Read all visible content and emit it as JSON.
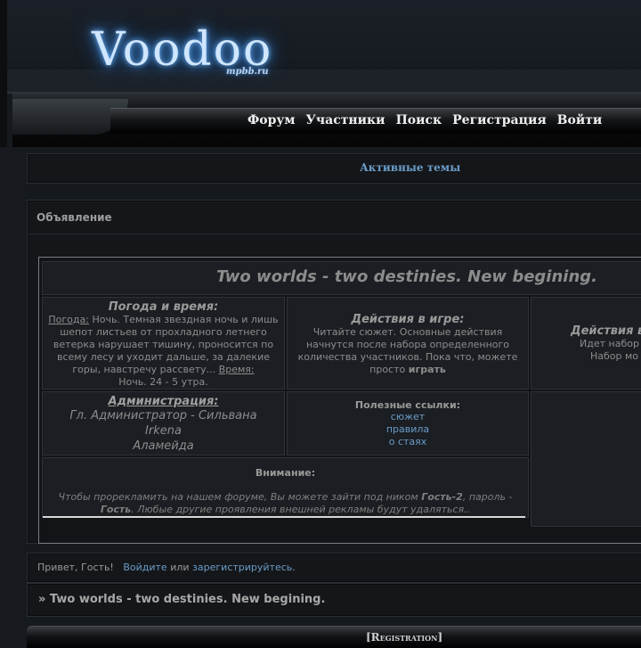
{
  "header": {
    "logo_text": "Voodoo",
    "logo_sub": "mpbb.ru"
  },
  "nav": {
    "items": [
      "Форум",
      "Участники",
      "Поиск",
      "Регистрация",
      "Войти"
    ]
  },
  "active_topics": "Активные темы",
  "announcement": {
    "title": "Объявление",
    "banner": "Two worlds - two destinies. New begining.",
    "weather": {
      "heading": "Погода и время:",
      "weather_label": "Погода:",
      "weather_text": "Ночь. Темная звездная ночь и лишь шепот листьев от прохладного летнего ветерка нарушает тишину, проносится по всему лесу и уходит дальше, за далекие горы, навстречу рассвету...",
      "time_label": "Время:",
      "time_text": "Ночь. 24 - 5 утра."
    },
    "actions": {
      "heading": "Действия в игре:",
      "text": "Читайте сюжет. Основные действия начнутся после набора определенного количества участников. Пока что, можете просто",
      "bold": "играть"
    },
    "actions_right": {
      "heading": "Действия в",
      "line1": "Идет набор",
      "line2": "Набор мо"
    },
    "admin": {
      "heading": "Администрация:",
      "lines": [
        "Гл. Администратор - Сильвана",
        "Irkena",
        "Аламейда"
      ]
    },
    "links": {
      "heading": "Полезные ссылки:",
      "items": [
        "сюжет",
        "правила",
        "о стаях"
      ]
    },
    "notice": {
      "heading": "Внимание:",
      "text1": "Чтобы прорекламить на нашем форуме, Вы можете зайти под ником ",
      "nick": "Гость-2",
      "text2": ", пароль - ",
      "password": "Гость",
      "text3": ". Любые другие проявления внешней рекламы будут удаляться.."
    }
  },
  "greeting": {
    "prefix": "Привет, Гость!",
    "login": "Войдите",
    "or": "или",
    "register": "зарегистрируйтесь",
    "suffix": "."
  },
  "breadcrumb": "» Two worlds - two destinies. New begining.",
  "registration_label": "[Registration]"
}
